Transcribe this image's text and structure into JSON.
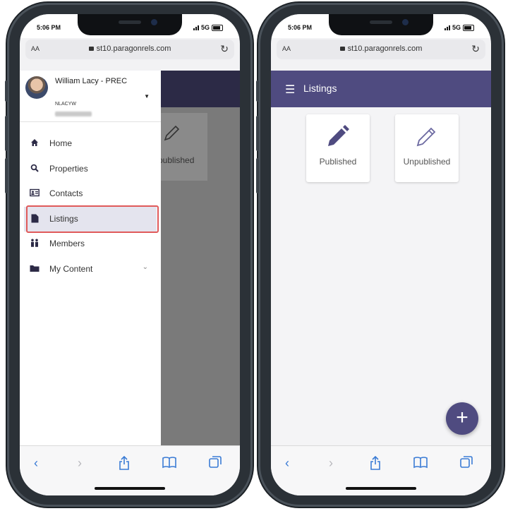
{
  "status": {
    "time": "5:06 PM",
    "network": "5G"
  },
  "browser": {
    "text_size_label": "AA",
    "url": "st10.paragonrels.com",
    "reload_icon": "reload-icon"
  },
  "app": {
    "title": "Listings",
    "menu_icon": "hamburger-icon"
  },
  "drawer": {
    "user_name": "William Lacy - PREC",
    "user_code": "NLACYW",
    "menu": [
      {
        "label": "Home",
        "icon": "home-icon"
      },
      {
        "label": "Properties",
        "icon": "search-icon"
      },
      {
        "label": "Contacts",
        "icon": "contact-card-icon"
      },
      {
        "label": "Listings",
        "icon": "document-icon",
        "selected": true
      },
      {
        "label": "Members",
        "icon": "members-icon"
      },
      {
        "label": "My Content",
        "icon": "folder-icon",
        "expandable": true
      }
    ]
  },
  "listings": {
    "cards": [
      {
        "label": "Published",
        "icon": "pencil-filled-icon"
      },
      {
        "label": "Unpublished",
        "icon": "pencil-outline-icon"
      }
    ],
    "ghost_card_label": "published"
  },
  "fab": {
    "label": "+",
    "icon": "plus-icon"
  },
  "toolbar": {
    "items": [
      "back-icon",
      "forward-icon",
      "share-icon",
      "bookmarks-icon",
      "tabs-icon"
    ]
  },
  "colors": {
    "appbar": "#4f4b80",
    "highlight": "#e05a5a",
    "link": "#3a7bd5"
  }
}
